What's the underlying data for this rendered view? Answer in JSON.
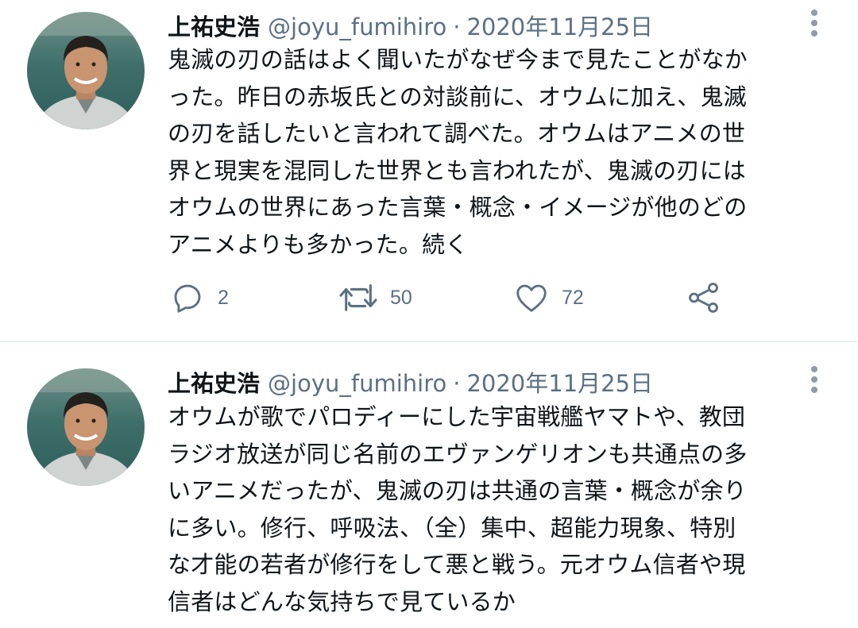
{
  "tweets": [
    {
      "author": {
        "display_name": "上祐史浩",
        "handle": "@joyu_fumihiro"
      },
      "separator": "·",
      "date": "2020年11月25日",
      "text_lines": [
        "鬼滅の刃の話はよく聞いたがなぜ今まで見たことがなか",
        "った。昨日の赤坂氏との対談前に、オウムに加え、鬼滅",
        "の刃を話したいと言われて調べた。オウムはアニメの世",
        "界と現実を混同した世界とも言われたが、鬼滅の刃には",
        "オウムの世界にあった言葉・概念・イメージが他のどの",
        "アニメよりも多かった。続く"
      ],
      "stats": {
        "replies": "2",
        "retweets": "50",
        "likes": "72"
      }
    },
    {
      "author": {
        "display_name": "上祐史浩",
        "handle": "@joyu_fumihiro"
      },
      "separator": "·",
      "date": "2020年11月25日",
      "text_lines": [
        "オウムが歌でパロディーにした宇宙戦艦ヤマトや、教団",
        "ラジオ放送が同じ名前のエヴァンゲリオンも共通点の多",
        "いアニメだったが、鬼滅の刃は共通の言葉・概念が余り",
        "に多い。修行、呼吸法、（全）集中、超能力現象、特別",
        "な才能の若者が修行をして悪と戦う。元オウム信者や現",
        "信者はどんな気持ちで見ているか"
      ]
    }
  ],
  "icons": {
    "reply": "reply-icon",
    "retweet": "retweet-icon",
    "like": "heart-icon",
    "share": "share-icon",
    "more": "more-vertical-icon"
  },
  "colors": {
    "text": "#0f1419",
    "secondary": "#5b7083",
    "icon": "#5b7083",
    "divider": "#e1e8ed"
  }
}
